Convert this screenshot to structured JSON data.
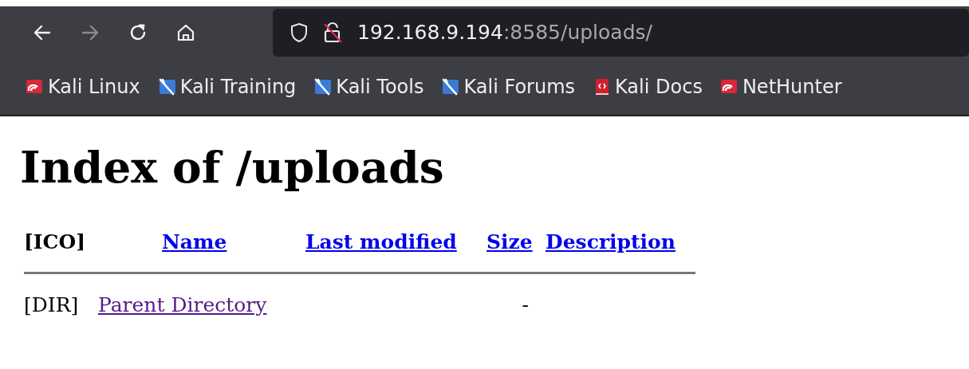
{
  "toolbar": {
    "nav_buttons": [
      {
        "kind": "back",
        "disabled": false
      },
      {
        "kind": "forward",
        "disabled": true
      },
      {
        "kind": "reload",
        "disabled": false
      },
      {
        "kind": "home",
        "disabled": false
      }
    ],
    "address": {
      "host": "192.168.9.194",
      "path": ":8585/uploads/"
    }
  },
  "bookmarks": [
    {
      "kind": "kali-red",
      "label": "Kali Linux"
    },
    {
      "kind": "kali-blue",
      "label": "Kali Training"
    },
    {
      "kind": "kali-blue",
      "label": "Kali Tools"
    },
    {
      "kind": "kali-blue",
      "label": "Kali Forums"
    },
    {
      "kind": "docs",
      "label": "Kali Docs"
    },
    {
      "kind": "kali-red",
      "label": "NetHunter"
    }
  ],
  "page": {
    "heading": "Index of /uploads",
    "columns": [
      {
        "kind": "text",
        "label": "[ICO]"
      },
      {
        "kind": "link",
        "label": "Name"
      },
      {
        "kind": "link",
        "label": "Last modified"
      },
      {
        "kind": "link",
        "label": "Size"
      },
      {
        "kind": "link",
        "label": "Description"
      }
    ],
    "rows": [
      {
        "icon": "[DIR]",
        "name": "Parent Directory",
        "visited": true,
        "size": "-"
      }
    ]
  }
}
